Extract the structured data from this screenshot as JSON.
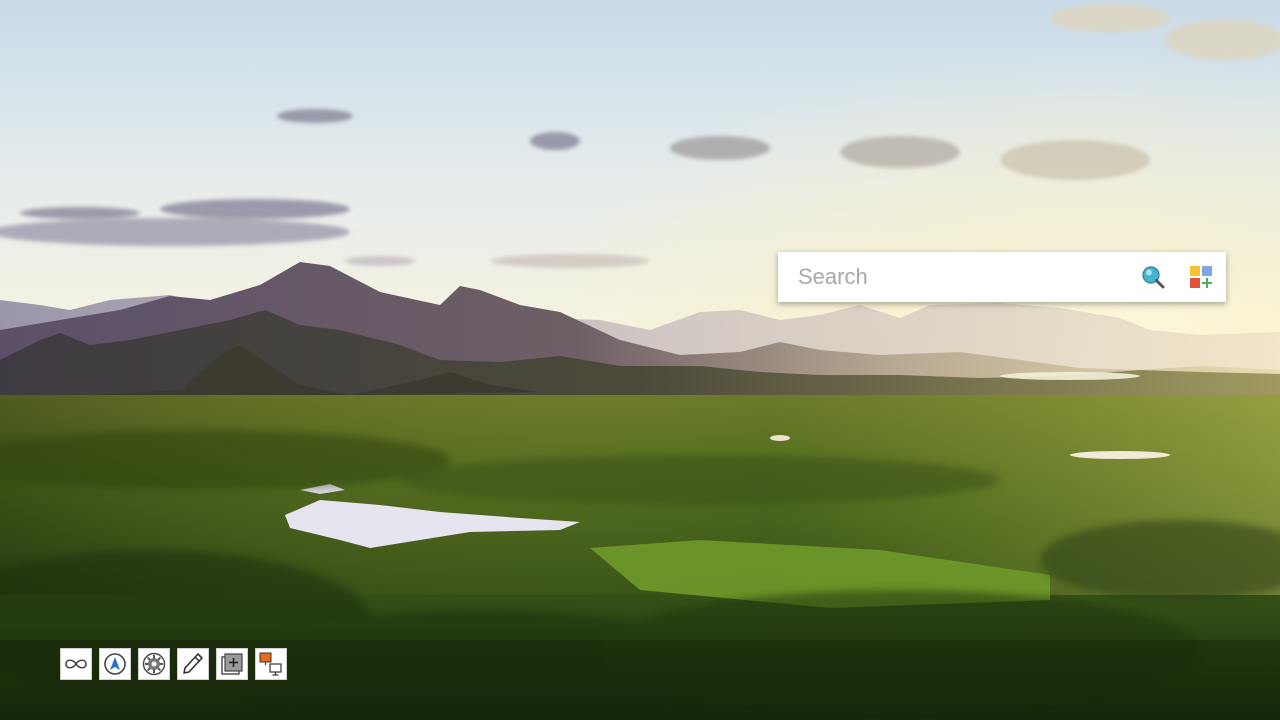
{
  "search": {
    "placeholder": "Search",
    "value": ""
  },
  "icons": {
    "search": "magnifier-icon",
    "apps": "apps-grid-plus-icon"
  },
  "toolbar": {
    "items": [
      {
        "icon": "infinity-icon"
      },
      {
        "icon": "compass-a-icon"
      },
      {
        "icon": "settings-gear-icon"
      },
      {
        "icon": "pencil-icon"
      },
      {
        "icon": "add-frame-icon"
      },
      {
        "icon": "screen-share-icon"
      }
    ]
  },
  "colors": {
    "searchbar_bg": "#ffffff",
    "placeholder": "#a8a8a8",
    "apps_yellow": "#f4c430",
    "apps_blue": "#7ea7e8",
    "apps_red": "#e0503a",
    "apps_green": "#4caf50",
    "magnifier_lens": "#45b4d0"
  }
}
